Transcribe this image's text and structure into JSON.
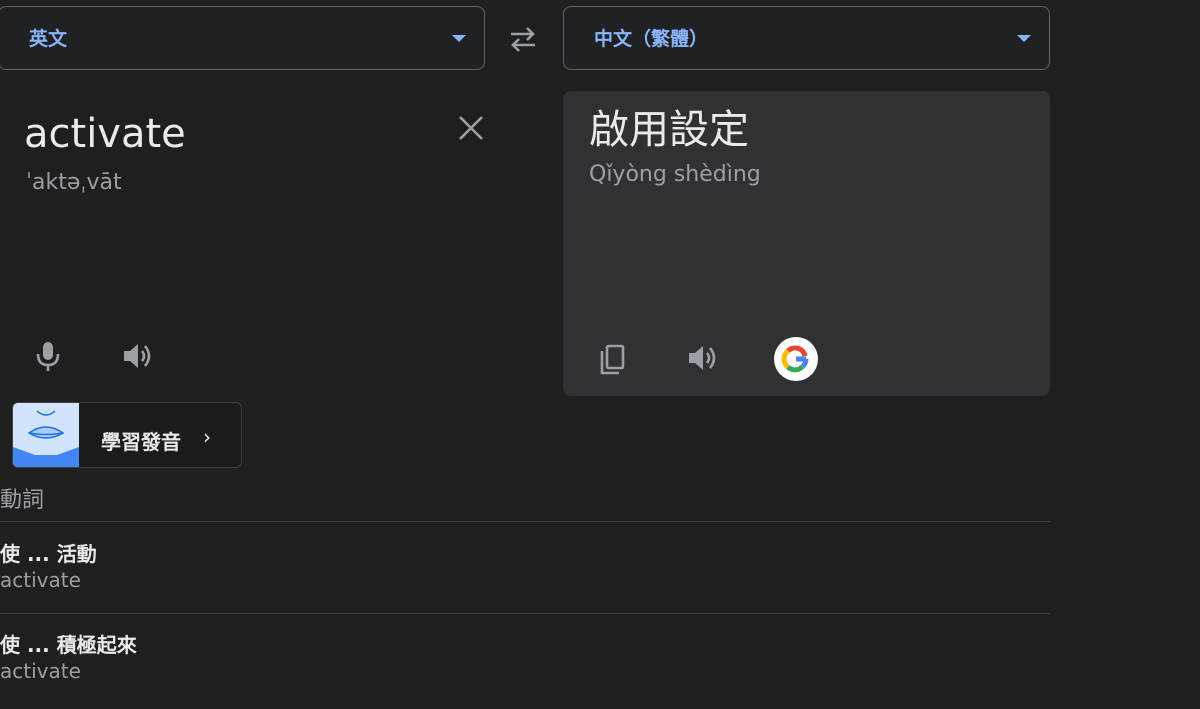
{
  "source_lang": {
    "label": "英文",
    "icon": "chevron-down-icon"
  },
  "target_lang": {
    "label": "中文（繁體）",
    "icon": "chevron-down-icon"
  },
  "swap": {
    "icon": "swap-arrows-icon"
  },
  "input": {
    "text": "activate",
    "phonetic": "ˈaktəˌvāt",
    "clear_icon": "close-icon",
    "mic_icon": "microphone-icon",
    "speaker_icon": "speaker-icon"
  },
  "pronunciation": {
    "label": "學習發音",
    "chevron": "›",
    "thumbnail_icon": "lips-icon"
  },
  "output": {
    "text": "啟用設定",
    "romanization": "Qǐyòng shèdìng",
    "copy_icon": "copy-icon",
    "speaker_icon": "speaker-icon",
    "google_icon": "google-logo-icon"
  },
  "dictionary": {
    "pos": "動詞",
    "entries": [
      {
        "term": "使 ... 活動",
        "back_translation": "activate"
      },
      {
        "term": "使 ... 積極起來",
        "back_translation": "activate"
      }
    ]
  },
  "colors": {
    "accent": "#8ab4f8",
    "background": "#1f1f1f",
    "panel": "#303134",
    "text_primary": "#e8eaed",
    "text_secondary": "#9aa0a6"
  }
}
